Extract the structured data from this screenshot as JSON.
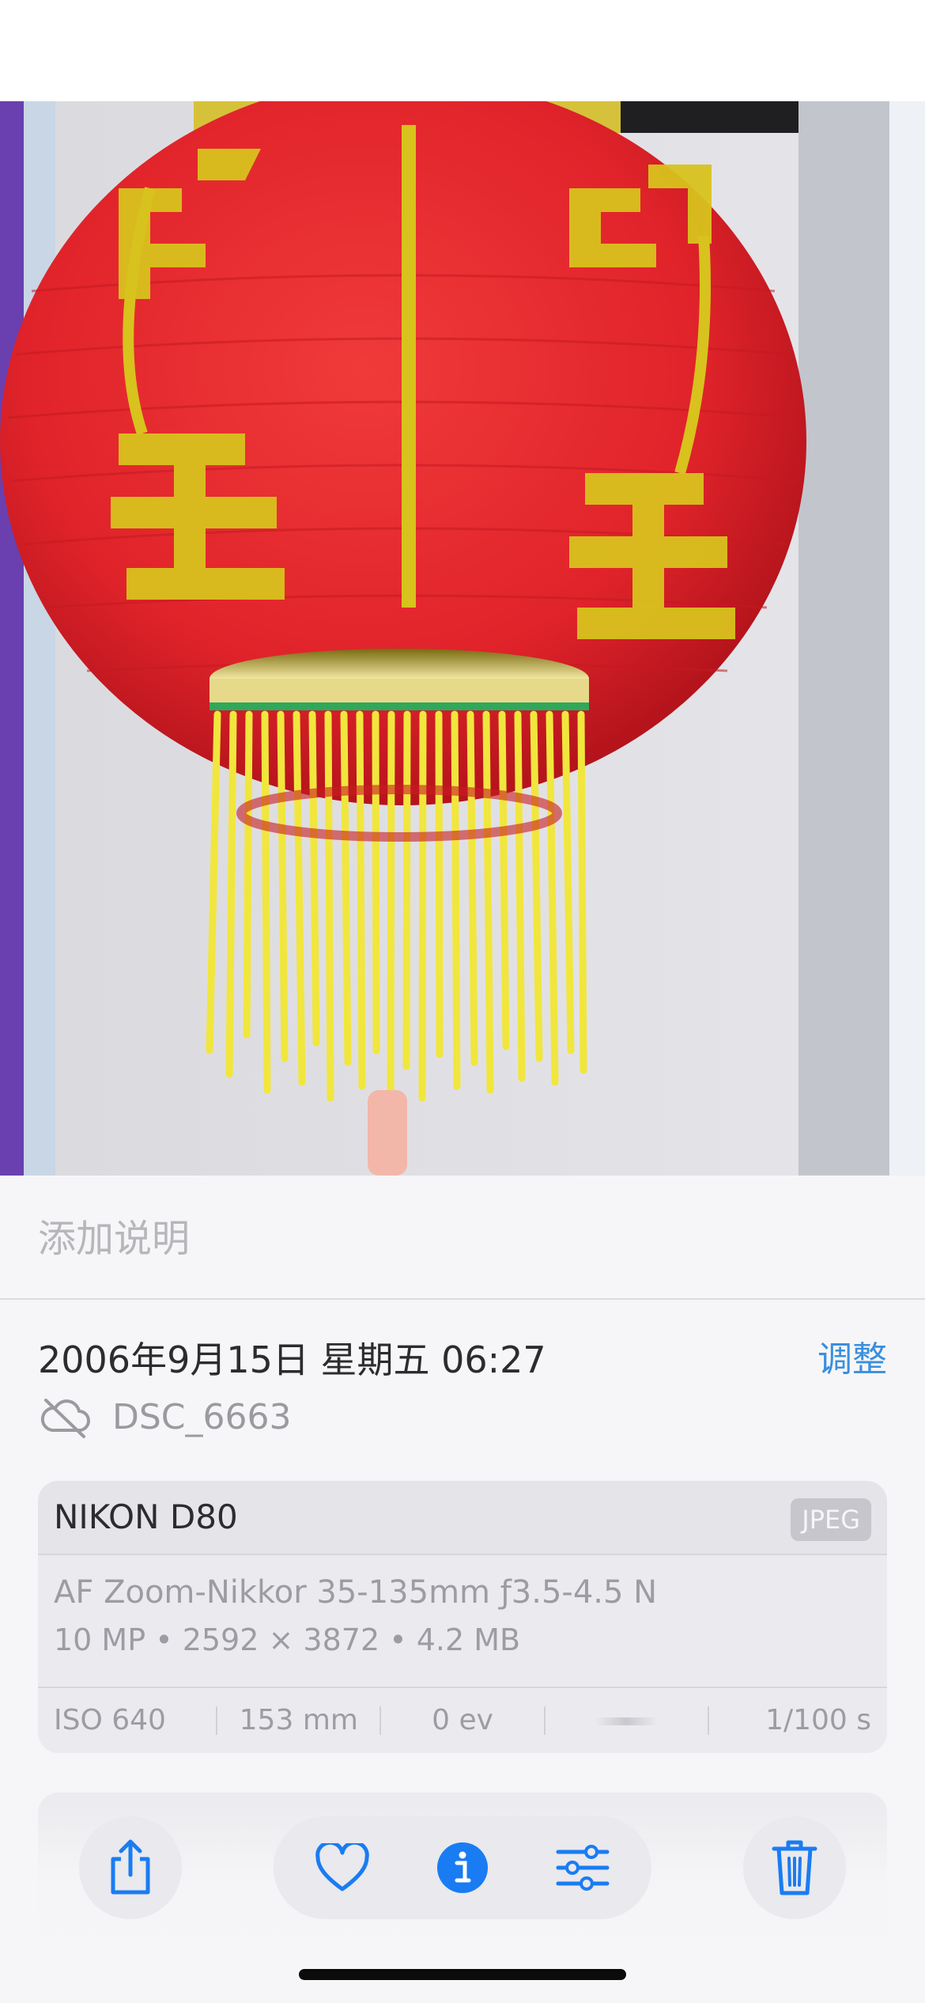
{
  "caption": {
    "placeholder": "添加说明"
  },
  "meta": {
    "datetime": "2006年9月15日 星期五 06:27",
    "adjust_label": "调整",
    "filename": "DSC_6663"
  },
  "exif": {
    "camera": "NIKON D80",
    "format": "JPEG",
    "lens": "AF Zoom-Nikkor 35-135mm ƒ3.5-4.5 N",
    "specs": "10 MP • 2592 × 3872 • 4.2 MB",
    "iso": "ISO 640",
    "focal": "153 mm",
    "ev": "0 ev",
    "shutter": "1/100 s"
  },
  "toolbar": {
    "share_icon": "share-icon",
    "favorite_icon": "heart-icon",
    "info_icon": "info-icon",
    "edit_icon": "sliders-icon",
    "delete_icon": "trash-icon",
    "accent": "#1a7cf2"
  },
  "colors": {
    "lantern_red": "#e3232a",
    "lantern_gold": "#d8c21e",
    "tassel_yellow": "#f0e640",
    "link_blue": "#3a8fde"
  }
}
